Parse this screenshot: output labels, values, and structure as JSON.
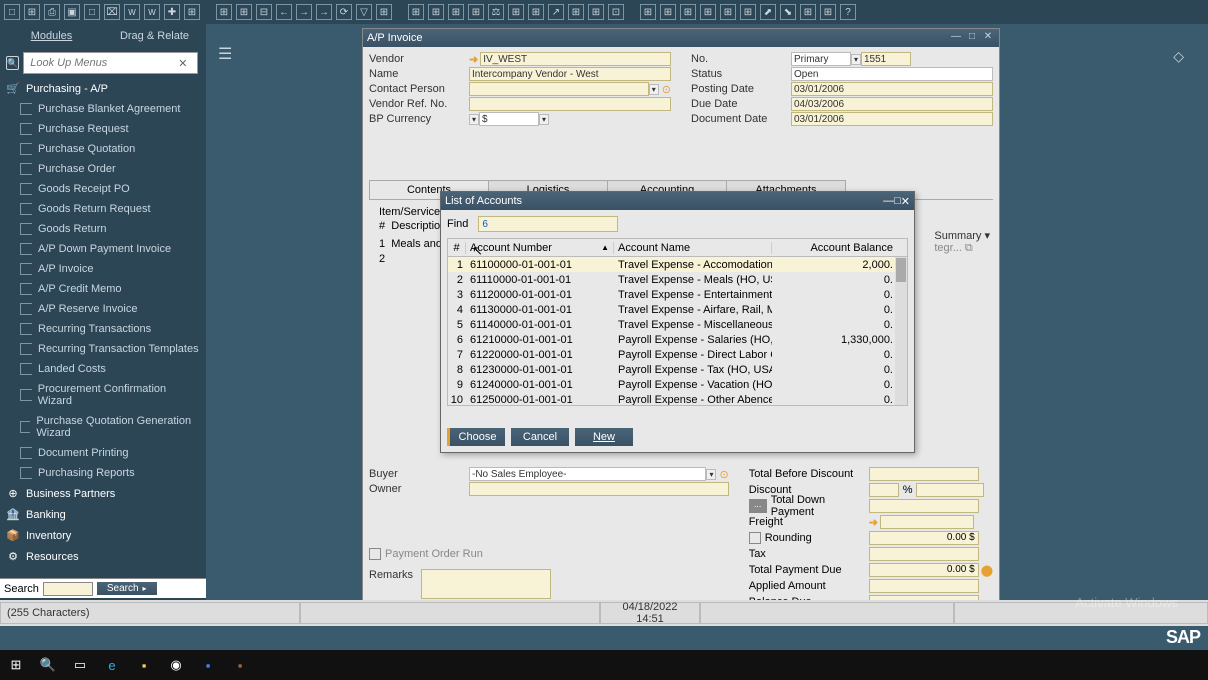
{
  "toolbar_icons": [
    "□",
    "⌘",
    "⎙",
    "▣",
    "□",
    "⌧",
    "w",
    "w",
    "✚",
    "⊞",
    "⊞",
    "⊞",
    "⊟",
    "←",
    "→",
    "⟲",
    "⟳",
    "▽",
    "⊞",
    "⊞",
    "⊞",
    "⊞",
    "⊞",
    "⚖",
    "⊞",
    "⊞",
    "↗",
    "⊞",
    "⊞",
    "⊡",
    "⊞",
    "⊞",
    "⊞",
    "⊞",
    "⊞",
    "⊞",
    "⬈",
    "⬊",
    "⊞",
    "⊞",
    "?"
  ],
  "sidebar": {
    "tab_modules": "Modules",
    "tab_drag": "Drag & Relate",
    "search_placeholder": "Look Up Menus",
    "section": "Purchasing - A/P",
    "items": [
      "Purchase Blanket Agreement",
      "Purchase Request",
      "Purchase Quotation",
      "Purchase Order",
      "Goods Receipt PO",
      "Goods Return Request",
      "Goods Return",
      "A/P Down Payment Invoice",
      "A/P Invoice",
      "A/P Credit Memo",
      "A/P Reserve Invoice",
      "Recurring Transactions",
      "Recurring Transaction Templates",
      "Landed Costs",
      "Procurement Confirmation Wizard",
      "Purchase Quotation Generation Wizard",
      "Document Printing",
      "Purchasing Reports"
    ],
    "groups": [
      {
        "icon": "⊕",
        "label": "Business Partners"
      },
      {
        "icon": "🏦",
        "label": "Banking"
      },
      {
        "icon": "📦",
        "label": "Inventory"
      },
      {
        "icon": "⚙",
        "label": "Resources"
      }
    ],
    "search_label": "Search",
    "search_btn": "Search"
  },
  "form": {
    "window_title": "A/P Invoice",
    "left": {
      "vendor_label": "Vendor",
      "vendor_value": "IV_WEST",
      "name_label": "Name",
      "name_value": "Intercompany Vendor - West",
      "contact_label": "Contact Person",
      "contact_value": "",
      "ref_label": "Vendor Ref. No.",
      "ref_value": "",
      "curr_label": "BP Currency",
      "curr_value": "$"
    },
    "right": {
      "no_label": "No.",
      "no_type": "Primary",
      "no_value": "1551",
      "status_label": "Status",
      "status_value": "Open",
      "posting_label": "Posting Date",
      "posting_value": "03/01/2006",
      "due_label": "Due Date",
      "due_value": "04/03/2006",
      "doc_label": "Document Date",
      "doc_value": "03/01/2006"
    },
    "tabs": [
      "Contents",
      "Logistics",
      "Accounting",
      "Attachments"
    ],
    "item_type_label": "Item/Service Type",
    "hash": "#",
    "desc_label": "Description",
    "row1_num": "1",
    "row1_desc": "Meals and Tr",
    "row2_num": "2",
    "summary_label": "Summary",
    "buyer_label": "Buyer",
    "buyer_value": "-No Sales Employee-",
    "owner_label": "Owner",
    "chk_label": "Payment Order Run",
    "remarks_label": "Remarks",
    "totals": {
      "tbefore": "Total Before Discount",
      "discount": "Discount",
      "pct": "%",
      "tdp": "Total Down Payment",
      "freight": "Freight",
      "rounding": "Rounding",
      "rounding_val": "0.00 $",
      "tax": "Tax",
      "tpd": "Total Payment Due",
      "tpd_val": "0.00 $",
      "applied": "Applied Amount",
      "balance": "Balance Due"
    }
  },
  "modal": {
    "title": "List of Accounts",
    "find_label": "Find",
    "find_value": "6",
    "head_num": "#",
    "head_acct": "Account Number",
    "head_name": "Account Name",
    "head_bal": "Account Balance",
    "rows": [
      {
        "n": "1",
        "num": "61100000-01-001-01",
        "name": "Travel Expense - Accomodation (HO, U",
        "bal": "2,000."
      },
      {
        "n": "2",
        "num": "61110000-01-001-01",
        "name": "Travel Expense - Meals (HO, USA, GA )",
        "bal": "0."
      },
      {
        "n": "3",
        "num": "61120000-01-001-01",
        "name": "Travel Expense - Entertainment (HO, U",
        "bal": "0."
      },
      {
        "n": "4",
        "num": "61130000-01-001-01",
        "name": "Travel Expense - Airfare, Rail, Mileage (",
        "bal": "0."
      },
      {
        "n": "5",
        "num": "61140000-01-001-01",
        "name": "Travel Expense - Miscellaneous (HO, US",
        "bal": "0."
      },
      {
        "n": "6",
        "num": "61210000-01-001-01",
        "name": "Payroll Expense - Salaries (HO, USA, GA",
        "bal": "1,330,000."
      },
      {
        "n": "7",
        "num": "61220000-01-001-01",
        "name": "Payroll Expense - Direct Labor Cost (H",
        "bal": "0."
      },
      {
        "n": "8",
        "num": "61230000-01-001-01",
        "name": "Payroll Expense - Tax (HO, USA, GA )",
        "bal": "0."
      },
      {
        "n": "9",
        "num": "61240000-01-001-01",
        "name": "Payroll Expense - Vacation (HO, USA, G",
        "bal": "0."
      },
      {
        "n": "10",
        "num": "61250000-01-001-01",
        "name": "Payroll Expense - Other Abences (HO,",
        "bal": "0."
      }
    ],
    "btn_choose": "Choose",
    "btn_cancel": "Cancel",
    "btn_new": "New"
  },
  "status": {
    "chars": "(255 Characters)",
    "date": "04/18/2022",
    "time": "14:51"
  },
  "watermark": "Activate Windows",
  "brand": "SAP"
}
